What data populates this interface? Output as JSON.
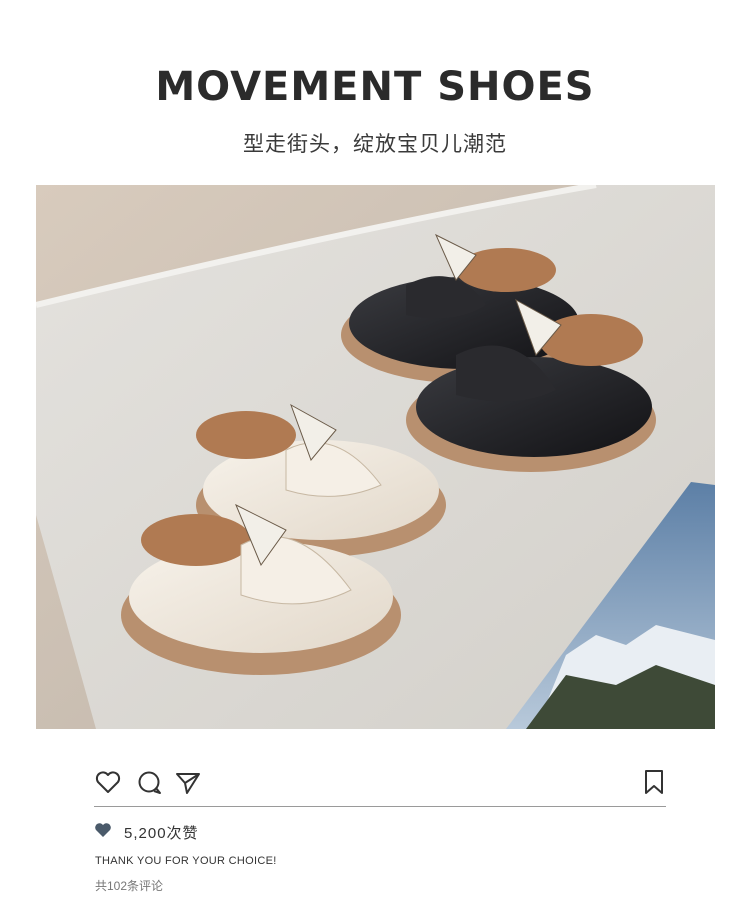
{
  "header": {
    "title": "MOVEMENT SHOES",
    "subtitle": "型走街头，绽放宝贝儿潮范"
  },
  "product_image": {
    "description_icon": "product-photo",
    "colors": {
      "background": "#cfc6bc",
      "cushion": "#e2dfda",
      "white_shoe": "#efe9df",
      "black_shoe": "#1d1d20",
      "sole": "#b8906f"
    }
  },
  "post_actions": {
    "like_icon": "heart-outline-icon",
    "comment_icon": "comment-bubble-icon",
    "share_icon": "send-icon",
    "save_icon": "bookmark-icon"
  },
  "likes": {
    "icon": "heart-filled-icon",
    "text": "5,200次赞"
  },
  "caption": "THANK YOU FOR YOUR CHOICE!",
  "comments_text": "共102条评论"
}
